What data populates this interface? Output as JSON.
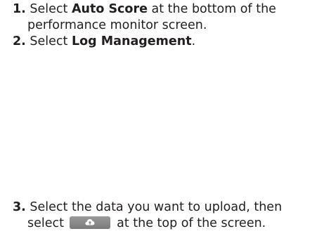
{
  "steps": [
    {
      "number": "1.",
      "pre": "Select ",
      "bold": "Auto Score",
      "post": " at the bottom of the performance monitor screen."
    },
    {
      "number": "2.",
      "pre": "Select ",
      "bold": "Log Management",
      "post": "."
    },
    {
      "number": "3.",
      "pre": "Select the data you want to upload, then select ",
      "icon": "cloud-upload-icon",
      "post": " at the top of the screen."
    }
  ],
  "colors": {
    "text": "#231f20",
    "button_gray": "#8a8a8a",
    "icon_white": "#ffffff"
  }
}
